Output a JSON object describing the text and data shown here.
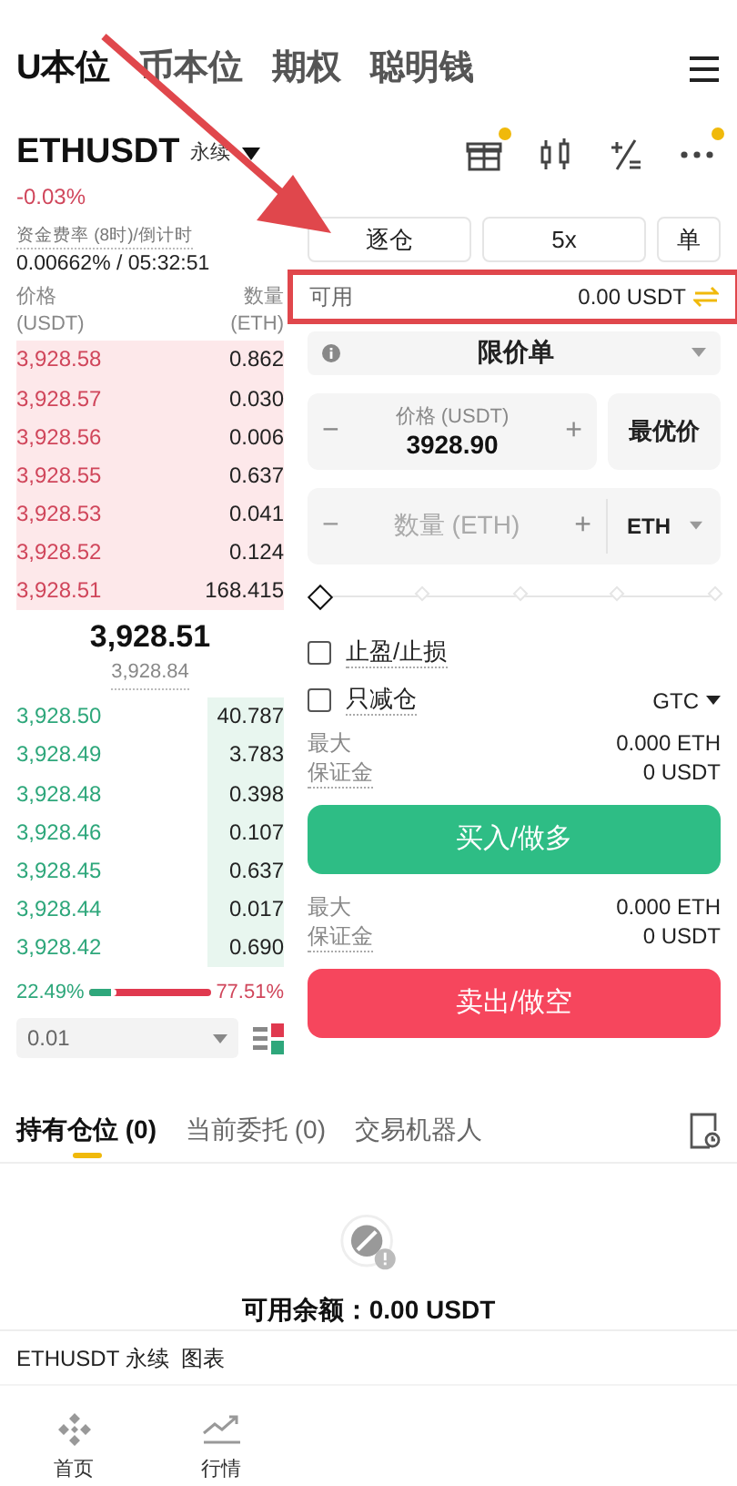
{
  "top_tabs": [
    {
      "label": "U本位",
      "selected": true
    },
    {
      "label": "币本位",
      "selected": false
    },
    {
      "label": "期权",
      "selected": false
    },
    {
      "label": "聪明钱",
      "selected": false
    }
  ],
  "symbol": {
    "name": "ETHUSDT",
    "type": "永续",
    "change": "-0.03%"
  },
  "header_icons": [
    {
      "kind": "gift",
      "dot": true
    },
    {
      "kind": "candles",
      "dot": false
    },
    {
      "kind": "calc",
      "dot": false
    },
    {
      "kind": "more",
      "dot": true
    }
  ],
  "funding": {
    "label": "资金费率 (8时)/倒计时",
    "value": "0.00662% / 05:32:51"
  },
  "orderbook": {
    "price_header": "价格",
    "price_unit": "(USDT)",
    "qty_header": "数量",
    "qty_unit": "(ETH)",
    "asks": [
      {
        "price": "3,928.58",
        "qty": "0.862"
      },
      {
        "price": "3,928.57",
        "qty": "0.030"
      },
      {
        "price": "3,928.56",
        "qty": "0.006"
      },
      {
        "price": "3,928.55",
        "qty": "0.637"
      },
      {
        "price": "3,928.53",
        "qty": "0.041"
      },
      {
        "price": "3,928.52",
        "qty": "0.124"
      },
      {
        "price": "3,928.51",
        "qty": "168.415"
      }
    ],
    "last_price": "3,928.51",
    "mark_price": "3,928.84",
    "bids": [
      {
        "price": "3,928.50",
        "qty": "40.787"
      },
      {
        "price": "3,928.49",
        "qty": "3.783"
      },
      {
        "price": "3,928.48",
        "qty": "0.398"
      },
      {
        "price": "3,928.46",
        "qty": "0.107"
      },
      {
        "price": "3,928.45",
        "qty": "0.637"
      },
      {
        "price": "3,928.44",
        "qty": "0.017"
      },
      {
        "price": "3,928.42",
        "qty": "0.690"
      }
    ],
    "ratio": {
      "buy": "22.49%",
      "sell": "77.51%",
      "level": 0.2249
    },
    "precision": "0.01"
  },
  "margin_buttons": [
    "逐仓",
    "5x",
    "单"
  ],
  "available": {
    "label": "可用",
    "value": "0.00 USDT"
  },
  "order_type": "限价单",
  "price_field": {
    "minus": "−",
    "label": "价格 (USDT)",
    "value": "3928.90",
    "plus": "+",
    "best": "最优价"
  },
  "qty_field": {
    "minus": "−",
    "placeholder": "数量 (ETH)",
    "plus": "+",
    "unit": "ETH"
  },
  "slider": {
    "steps": [
      {
        "selected": true
      },
      {
        "selected": false
      },
      {
        "selected": false
      },
      {
        "selected": false
      },
      {
        "selected": false
      }
    ]
  },
  "options": [
    {
      "label": "止盈/止损",
      "checked": false
    },
    {
      "label": "只减仓",
      "checked": false
    }
  ],
  "tif": "GTC",
  "buy": {
    "max_label": "最大",
    "max_value": "0.000 ETH",
    "margin_label": "保证金",
    "margin_value": "0 USDT",
    "button": "买入/做多"
  },
  "sell": {
    "max_label": "最大",
    "max_value": "0.000 ETH",
    "margin_label": "保证金",
    "margin_value": "0 USDT",
    "button": "卖出/做空"
  },
  "bottom_tabs": [
    {
      "label": "持有仓位 (0)",
      "selected": true
    },
    {
      "label": "当前委托 (0)",
      "selected": false
    },
    {
      "label": "交易机器人",
      "selected": false
    }
  ],
  "empty_text": "可用余额：0.00 USDT",
  "chart_bar": "ETHUSDT 永续  图表",
  "nav": [
    {
      "label": "首页",
      "kind": "home"
    },
    {
      "label": "行情",
      "kind": "markets"
    }
  ]
}
